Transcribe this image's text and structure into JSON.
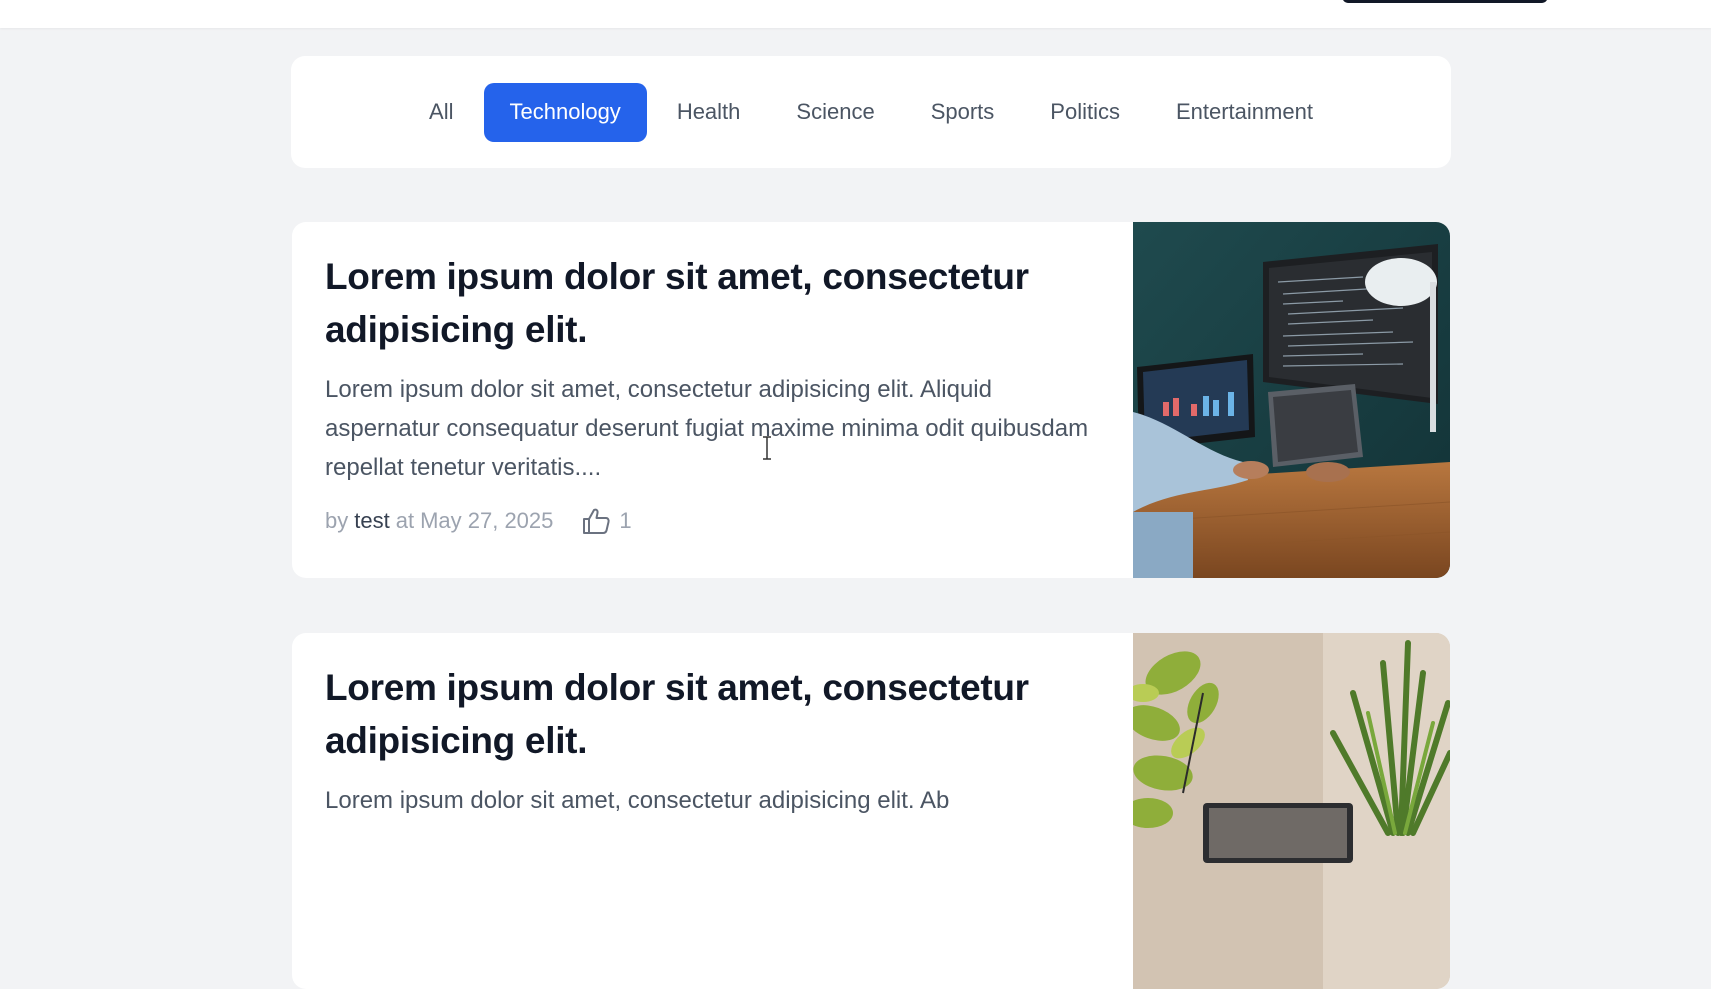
{
  "filters": {
    "items": [
      "All",
      "Technology",
      "Health",
      "Science",
      "Sports",
      "Politics",
      "Entertainment"
    ],
    "active": "Technology"
  },
  "posts": [
    {
      "title": "Lorem ipsum dolor sit amet, consectetur adipisicing elit.",
      "excerpt": "Lorem ipsum dolor sit amet, consectetur adipisicing elit. Aliquid aspernatur consequatur deserunt fugiat maxime minima odit quibusdam repellat tenetur veritatis....",
      "by": "by",
      "author": "test",
      "at": "at",
      "date": "May 27, 2025",
      "likes": "1",
      "image": "laptops-code-desk"
    },
    {
      "title": "Lorem ipsum dolor sit amet, consectetur adipisicing elit.",
      "excerpt": "Lorem ipsum dolor sit amet, consectetur adipisicing elit. Ab",
      "image": "plants-laptop"
    }
  ],
  "colors": {
    "accent": "#2563eb",
    "background": "#f2f3f5",
    "card": "#ffffff",
    "title": "#111827",
    "muted": "#9ca3af"
  },
  "icons": {
    "like": "thumbs-up-icon",
    "cursor": "text-cursor-icon"
  }
}
